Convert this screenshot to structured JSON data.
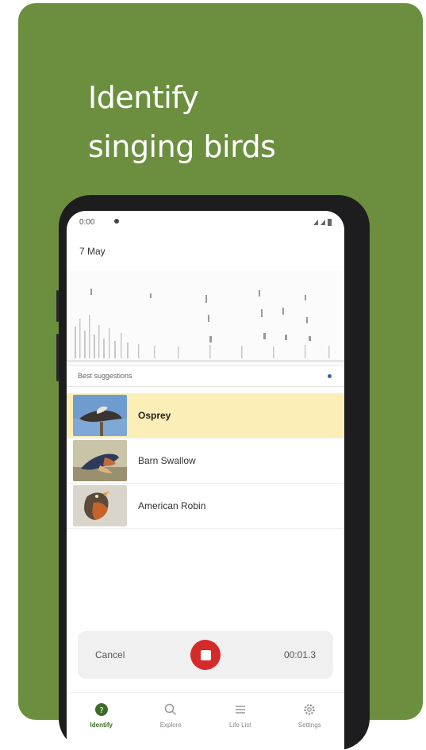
{
  "headline": {
    "line1": "Identify",
    "line2": "singing birds"
  },
  "status_bar": {
    "time": "0:00"
  },
  "recording": {
    "date": "7 May"
  },
  "suggestions": {
    "header": "Best suggestions",
    "items": [
      {
        "name": "Osprey",
        "selected": true,
        "icon": "osprey-photo"
      },
      {
        "name": "Barn Swallow",
        "selected": false,
        "icon": "barn-swallow-photo"
      },
      {
        "name": "American Robin",
        "selected": false,
        "icon": "american-robin-photo"
      }
    ]
  },
  "controls": {
    "cancel_label": "Cancel",
    "timer": "00:01.3"
  },
  "nav": {
    "items": [
      {
        "label": "Identify",
        "icon": "question-circle-icon",
        "active": true
      },
      {
        "label": "Explore",
        "icon": "search-icon",
        "active": false
      },
      {
        "label": "Life List",
        "icon": "list-icon",
        "active": false
      },
      {
        "label": "Settings",
        "icon": "gear-icon",
        "active": false
      }
    ]
  },
  "colors": {
    "background": "#6b8f3f",
    "selected_row": "#fbeeb6",
    "stop_button": "#d42a2a",
    "active_nav": "#3d6b2a"
  }
}
